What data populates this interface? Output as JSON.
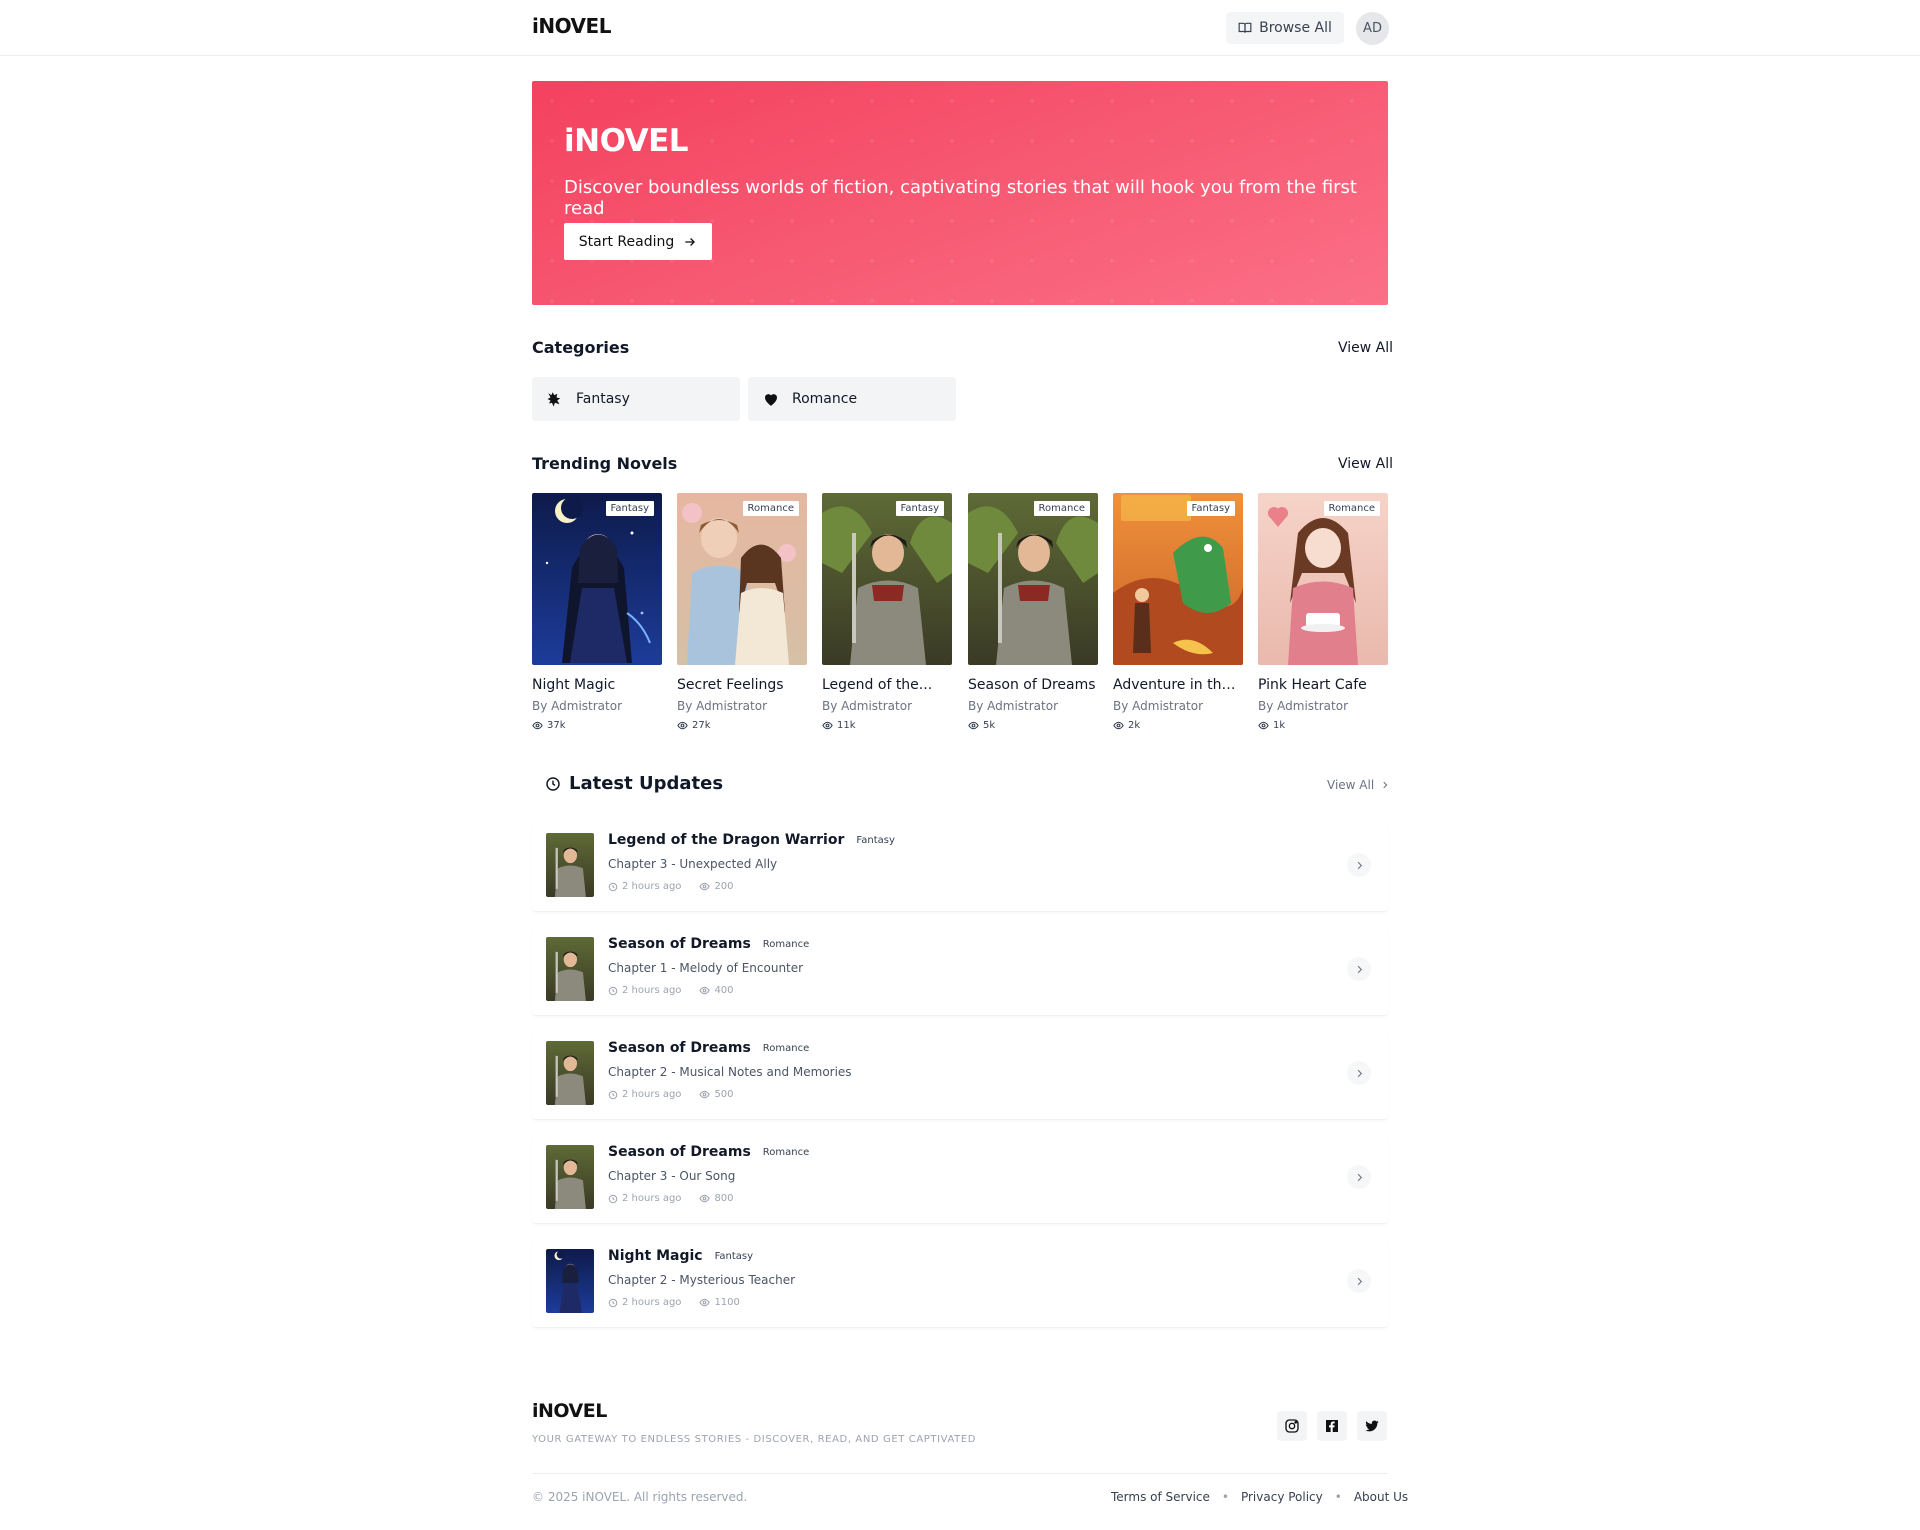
{
  "header": {
    "brand": "iNOVEL",
    "browse_label": "Browse All",
    "avatar_initials": "AD"
  },
  "hero": {
    "title": "iNOVEL",
    "subtitle": "Discover boundless worlds of fiction, captivating stories that will hook you from the first read",
    "cta_label": "Start Reading",
    "gradient": [
      "#f4415f",
      "#fb7087"
    ]
  },
  "categories": {
    "title": "Categories",
    "view_all": "View All",
    "items": [
      {
        "label": "Fantasy",
        "icon": "dragon-icon"
      },
      {
        "label": "Romance",
        "icon": "heart-icon"
      }
    ]
  },
  "trending": {
    "title": "Trending Novels",
    "view_all": "View All",
    "novels": [
      {
        "title": "Night Magic",
        "author": "By Admistrator",
        "views": "37k",
        "genre": "Fantasy"
      },
      {
        "title": "Secret Feelings",
        "author": "By Admistrator",
        "views": "27k",
        "genre": "Romance"
      },
      {
        "title": "Legend of the...",
        "author": "By Admistrator",
        "views": "11k",
        "genre": "Fantasy"
      },
      {
        "title": "Season of Dreams",
        "author": "By Admistrator",
        "views": "5k",
        "genre": "Romance"
      },
      {
        "title": "Adventure in the...",
        "author": "By Admistrator",
        "views": "2k",
        "genre": "Fantasy"
      },
      {
        "title": "Pink Heart Cafe",
        "author": "By Admistrator",
        "views": "1k",
        "genre": "Romance"
      }
    ]
  },
  "latest": {
    "title": "Latest Updates",
    "view_all": "View All",
    "updates": [
      {
        "title": "Legend of the Dragon Warrior",
        "genre": "Fantasy",
        "chapter": "Chapter 3 - Unexpected Ally",
        "time": "2 hours ago",
        "views": "200"
      },
      {
        "title": "Season of Dreams",
        "genre": "Romance",
        "chapter": "Chapter 1 - Melody of Encounter",
        "time": "2 hours ago",
        "views": "400"
      },
      {
        "title": "Season of Dreams",
        "genre": "Romance",
        "chapter": "Chapter 2 - Musical Notes and Memories",
        "time": "2 hours ago",
        "views": "500"
      },
      {
        "title": "Season of Dreams",
        "genre": "Romance",
        "chapter": "Chapter 3 - Our Song",
        "time": "2 hours ago",
        "views": "800"
      },
      {
        "title": "Night Magic",
        "genre": "Fantasy",
        "chapter": "Chapter 2 - Mysterious Teacher",
        "time": "2 hours ago",
        "views": "1100"
      }
    ]
  },
  "footer": {
    "brand": "iNOVEL",
    "tagline": "YOUR GATEWAY TO ENDLESS STORIES - DISCOVER, READ, AND GET CAPTIVATED",
    "social": [
      "instagram-icon",
      "facebook-icon",
      "twitter-icon"
    ],
    "copyright": "© 2025 iNOVEL. All rights reserved.",
    "links": [
      "Terms of Service",
      "Privacy Policy",
      "About Us"
    ],
    "link_separator": "•"
  }
}
